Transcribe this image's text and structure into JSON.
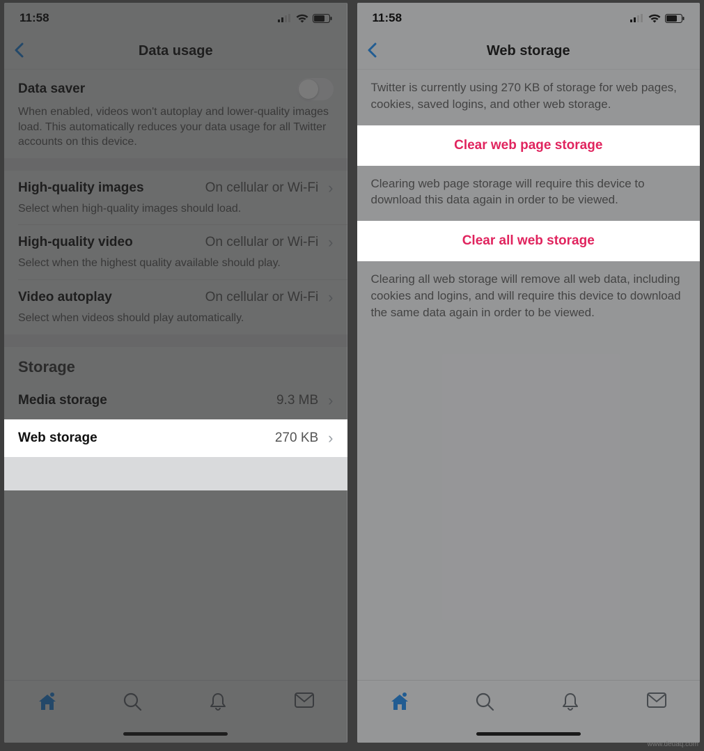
{
  "status": {
    "time": "11:58"
  },
  "left": {
    "title": "Data usage",
    "data_saver": {
      "label": "Data saver",
      "desc": "When enabled, videos won't autoplay and lower-quality images load. This automatically reduces your data usage for all Twitter accounts on this device."
    },
    "hq_images": {
      "label": "High-quality images",
      "value": "On cellular or Wi-Fi",
      "desc": "Select when high-quality images should load."
    },
    "hq_video": {
      "label": "High-quality video",
      "value": "On cellular or Wi-Fi",
      "desc": "Select when the highest quality available should play."
    },
    "autoplay": {
      "label": "Video autoplay",
      "value": "On cellular or Wi-Fi",
      "desc": "Select when videos should play automatically."
    },
    "storage_header": "Storage",
    "media_storage": {
      "label": "Media storage",
      "value": "9.3 MB"
    },
    "web_storage": {
      "label": "Web storage",
      "value": "270 KB"
    }
  },
  "right": {
    "title": "Web storage",
    "intro": "Twitter is currently using 270 KB of storage for web pages, cookies, saved logins, and other web storage.",
    "clear_page": "Clear web page storage",
    "clear_page_desc": "Clearing web page storage will require this device to download this data again in order to be viewed.",
    "clear_all": "Clear all web storage",
    "clear_all_desc": "Clearing all web storage will remove all web data, including cookies and logins, and will require this device to download the same data again in order to be viewed."
  },
  "watermark": "www.deuaq.com"
}
